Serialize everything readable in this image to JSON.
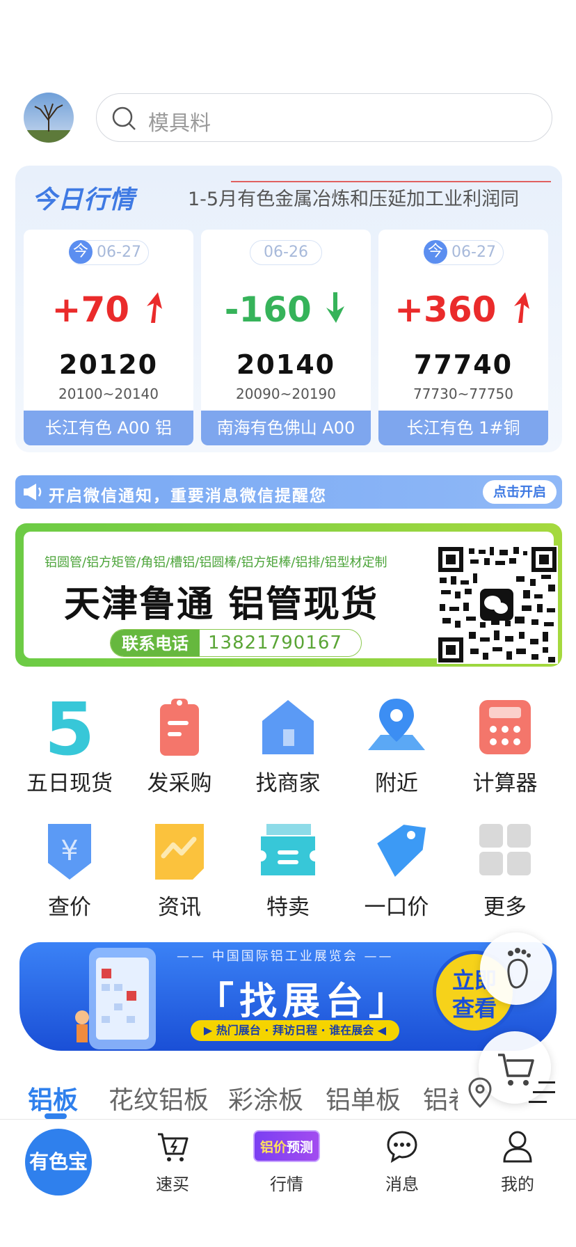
{
  "search": {
    "placeholder": "模具料"
  },
  "market": {
    "title": "今日行情",
    "headline": "1-5月有色金属冶炼和压延加工业利润同",
    "today_badge": "今",
    "cards": [
      {
        "date": "06-27",
        "is_today": true,
        "change": "+70",
        "direction": "up",
        "price": "20120",
        "range": "20100~20140",
        "name": "长江有色 A00 铝"
      },
      {
        "date": "06-26",
        "is_today": false,
        "change": "-160",
        "direction": "down",
        "price": "20140",
        "range": "20090~20190",
        "name": "南海有色佛山 A00"
      },
      {
        "date": "06-27",
        "is_today": true,
        "change": "+360",
        "direction": "up",
        "price": "77740",
        "range": "77730~77750",
        "name": "长江有色 1#铜"
      }
    ]
  },
  "notice": {
    "text": "开启微信通知，重要消息微信提醒您",
    "button": "点击开启"
  },
  "ad": {
    "categories": "铝圆管/铝方矩管/角铝/槽铝/铝圆棒/铝方矩棒/铝排/铝型材定制",
    "slogan": "天津鲁通 铝管现货",
    "phone_label": "联系电话",
    "phone": "13821790167"
  },
  "grid": [
    {
      "label": "五日现货",
      "icon": "five-day-icon"
    },
    {
      "label": "发采购",
      "icon": "clipboard-icon"
    },
    {
      "label": "找商家",
      "icon": "shop-icon"
    },
    {
      "label": "附近",
      "icon": "map-pin-icon"
    },
    {
      "label": "计算器",
      "icon": "calculator-icon"
    },
    {
      "label": "查价",
      "icon": "yen-shield-icon"
    },
    {
      "label": "资讯",
      "icon": "news-icon"
    },
    {
      "label": "特卖",
      "icon": "ticket-icon"
    },
    {
      "label": "一口价",
      "icon": "tag-icon"
    },
    {
      "label": "更多",
      "icon": "more-grid-icon"
    }
  ],
  "banner": {
    "subtitle": "—— 中国国际铝工业展览会 ——",
    "main": "「找展台」",
    "tags": "▶ 热门展台 · 拜访日程 · 谁在展会 ◀",
    "button_line1": "立即",
    "button_line2": "查看"
  },
  "tabs": [
    "铝板",
    "花纹铝板",
    "彩涂板",
    "铝单板",
    "铝卷"
  ],
  "bottom_nav": {
    "home": "有色宝",
    "items": [
      {
        "label": "速买",
        "icon": "cart-bolt-icon"
      },
      {
        "label": "行情",
        "icon": "price-forecast-badge"
      },
      {
        "label": "消息",
        "icon": "chat-icon"
      },
      {
        "label": "我的",
        "icon": "user-icon"
      }
    ],
    "forecast_badge_a": "铝价",
    "forecast_badge_b": "预测"
  },
  "colors": {
    "accent": "#2f80ed",
    "up": "#ea2b2b",
    "down": "#36b35a",
    "card_footer": "#7ea6ee"
  }
}
